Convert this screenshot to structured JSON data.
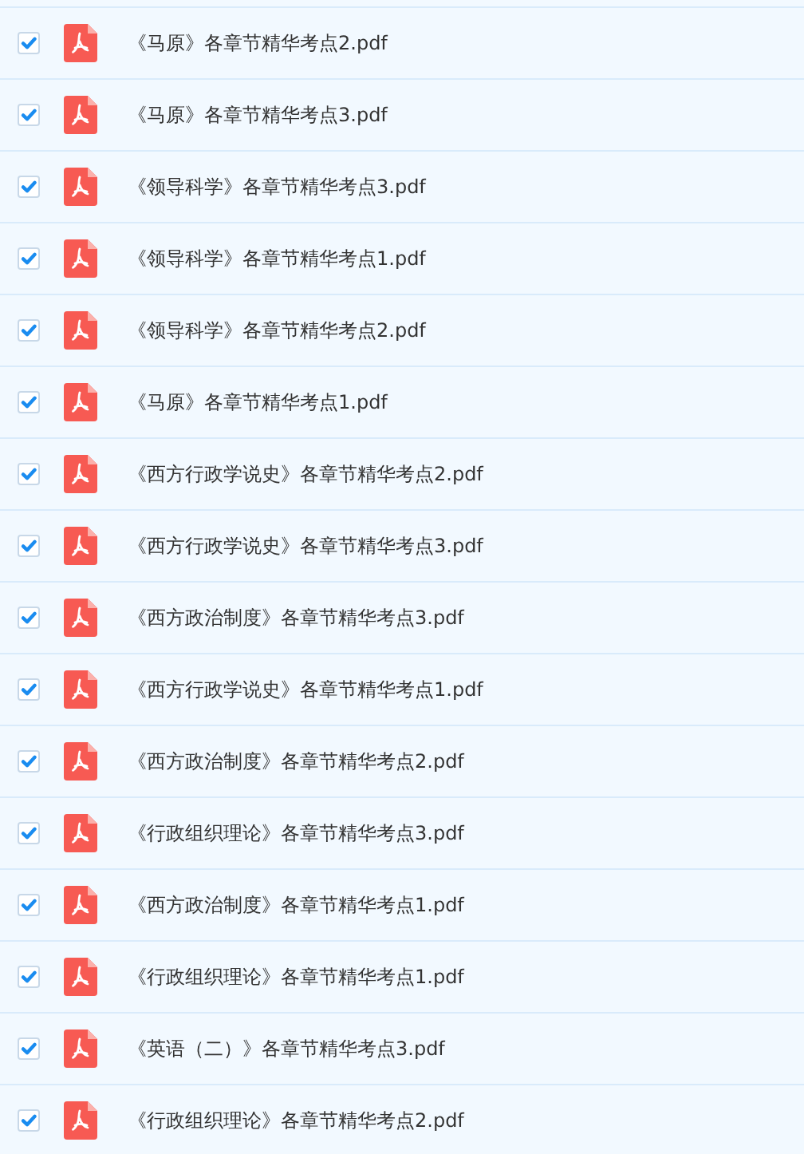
{
  "files": [
    {
      "name": "《马原》各章节精华考点2.pdf",
      "checked": true
    },
    {
      "name": "《马原》各章节精华考点3.pdf",
      "checked": true
    },
    {
      "name": "《领导科学》各章节精华考点3.pdf",
      "checked": true
    },
    {
      "name": "《领导科学》各章节精华考点1.pdf",
      "checked": true
    },
    {
      "name": "《领导科学》各章节精华考点2.pdf",
      "checked": true
    },
    {
      "name": "《马原》各章节精华考点1.pdf",
      "checked": true
    },
    {
      "name": "《西方行政学说史》各章节精华考点2.pdf",
      "checked": true
    },
    {
      "name": "《西方行政学说史》各章节精华考点3.pdf",
      "checked": true
    },
    {
      "name": "《西方政治制度》各章节精华考点3.pdf",
      "checked": true
    },
    {
      "name": "《西方行政学说史》各章节精华考点1.pdf",
      "checked": true
    },
    {
      "name": "《西方政治制度》各章节精华考点2.pdf",
      "checked": true
    },
    {
      "name": "《行政组织理论》各章节精华考点3.pdf",
      "checked": true
    },
    {
      "name": "《西方政治制度》各章节精华考点1.pdf",
      "checked": true
    },
    {
      "name": "《行政组织理论》各章节精华考点1.pdf",
      "checked": true
    },
    {
      "name": "《英语（二）》各章节精华考点3.pdf",
      "checked": true
    },
    {
      "name": "《行政组织理论》各章节精华考点2.pdf",
      "checked": true
    }
  ]
}
